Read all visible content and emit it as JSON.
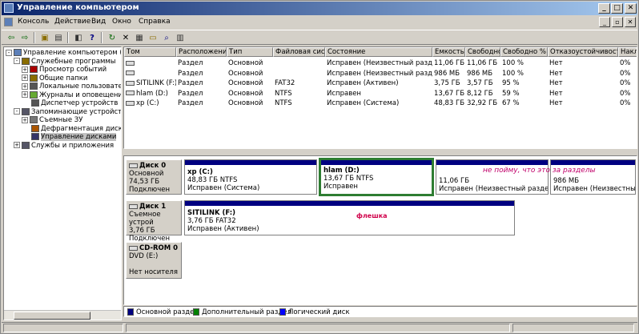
{
  "window": {
    "title": "Управление компьютером"
  },
  "menu": [
    "Консоль",
    "Действие",
    "Вид",
    "Окно",
    "Справка"
  ],
  "toolbar": {
    "icons": [
      "back-icon",
      "forward-icon",
      "up-folder-icon",
      "show-tree-icon",
      "properties-icon",
      "help-icon",
      "refresh-icon",
      "delete-icon",
      "properties2-icon",
      "folder-icon",
      "search-icon",
      "export-icon"
    ],
    "glyphs": [
      "⇦",
      "⇨",
      "▣",
      "▤",
      "◧",
      "?",
      "↻",
      "✕",
      "▦",
      "▭",
      "⌕",
      "▥"
    ]
  },
  "tree": {
    "items": [
      {
        "label": "Управление компьютером (локаль",
        "level": 0,
        "exp": "-",
        "icon": "computer-icon"
      },
      {
        "label": "Служебные программы",
        "level": 1,
        "exp": "-",
        "icon": "tools-icon"
      },
      {
        "label": "Просмотр событий",
        "level": 2,
        "exp": "+",
        "icon": "event-viewer-icon"
      },
      {
        "label": "Общие папки",
        "level": 2,
        "exp": "+",
        "icon": "shared-folders-icon"
      },
      {
        "label": "Локальные пользователи",
        "level": 2,
        "exp": "+",
        "icon": "users-icon"
      },
      {
        "label": "Журналы и оповещения п",
        "level": 2,
        "exp": "+",
        "icon": "logs-icon"
      },
      {
        "label": "Диспетчер устройств",
        "level": 2,
        "exp": "",
        "icon": "device-manager-icon"
      },
      {
        "label": "Запоминающие устройства",
        "level": 1,
        "exp": "-",
        "icon": "storage-icon"
      },
      {
        "label": "Съемные ЗУ",
        "level": 2,
        "exp": "+",
        "icon": "removable-storage-icon"
      },
      {
        "label": "Дефрагментация диска",
        "level": 2,
        "exp": "",
        "icon": "defrag-icon"
      },
      {
        "label": "Управление дисками",
        "level": 2,
        "exp": "",
        "icon": "disk-management-icon",
        "selected": true
      },
      {
        "label": "Службы и приложения",
        "level": 1,
        "exp": "+",
        "icon": "services-icon"
      }
    ]
  },
  "volume_list": {
    "headers": [
      "Том",
      "Расположение",
      "Тип",
      "Файловая система",
      "Состояние",
      "Емкость",
      "Свободно",
      "Свободно %",
      "Отказоустойчивость",
      "Накла"
    ],
    "rows": [
      [
        "",
        "Раздел",
        "Основной",
        "",
        "Исправен (Неизвестный раздел)",
        "11,06 ГБ",
        "11,06 ГБ",
        "100 %",
        "Нет",
        "0%"
      ],
      [
        "",
        "Раздел",
        "Основной",
        "",
        "Исправен (Неизвестный раздел)",
        "986 МБ",
        "986 МБ",
        "100 %",
        "Нет",
        "0%"
      ],
      [
        "SITILINK (F:)",
        "Раздел",
        "Основной",
        "FAT32",
        "Исправен (Активен)",
        "3,75 ГБ",
        "3,57 ГБ",
        "95 %",
        "Нет",
        "0%"
      ],
      [
        "hlam (D:)",
        "Раздел",
        "Основной",
        "NTFS",
        "Исправен",
        "13,67 ГБ",
        "8,12 ГБ",
        "59 %",
        "Нет",
        "0%"
      ],
      [
        "xp (C:)",
        "Раздел",
        "Основной",
        "NTFS",
        "Исправен (Система)",
        "48,83 ГБ",
        "32,92 ГБ",
        "67 %",
        "Нет",
        "0%"
      ]
    ]
  },
  "disks": [
    {
      "name": "Диск 0",
      "info": [
        "Основной",
        "74,53 ГБ",
        "Подключен"
      ],
      "partitions": [
        {
          "name": "xp  (C:)",
          "size": "48,83 ГБ NTFS",
          "status": "Исправен (Система)"
        },
        {
          "name": "hlam  (D:)",
          "size": "13,67 ГБ NTFS",
          "status": "Исправен"
        },
        {
          "name": "",
          "size": "11,06 ГБ",
          "status": "Исправен (Неизвестный раздел)"
        },
        {
          "name": "",
          "size": "986 МБ",
          "status": "Исправен (Неизвестный разд"
        }
      ]
    },
    {
      "name": "Диск 1",
      "info": [
        "Съемное устрой",
        "3,76 ГБ",
        "Подключен"
      ],
      "partitions": [
        {
          "name": "SITILINK  (F:)",
          "size": "3,76 ГБ FAT32",
          "status": "Исправен (Активен)"
        }
      ]
    },
    {
      "name": "CD-ROM 0",
      "info": [
        "DVD (E:)",
        "",
        "Нет носителя"
      ],
      "partitions": []
    }
  ],
  "annotations": {
    "partitions_note": "не пойму, что это за разделы",
    "flash_note": "флешка"
  },
  "legend": [
    {
      "label": "Основной раздел",
      "color": "#000080"
    },
    {
      "label": "Дополнительный раздел",
      "color": "#008000"
    },
    {
      "label": "Логический диск",
      "color": "#0000ff"
    }
  ],
  "colors": {
    "primary_partition": "#000080",
    "highlight_box": "#2e7d32",
    "selection": "#c0c0c0"
  }
}
